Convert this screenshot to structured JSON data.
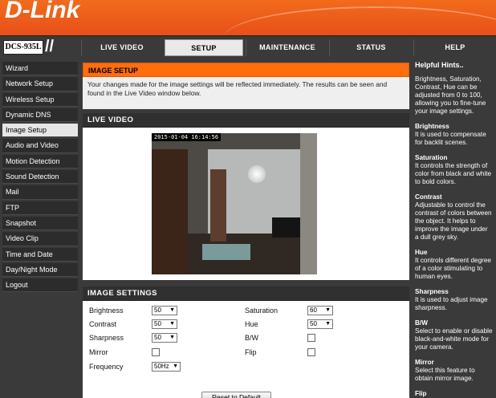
{
  "brand": {
    "logo": "D-Link",
    "model": "DCS-935L"
  },
  "nav": {
    "tabs": [
      "LIVE VIDEO",
      "SETUP",
      "MAINTENANCE",
      "STATUS",
      "HELP"
    ],
    "active": "SETUP"
  },
  "sidebar": {
    "items": [
      {
        "label": "Wizard"
      },
      {
        "label": "Network Setup"
      },
      {
        "label": "Wireless Setup"
      },
      {
        "label": "Dynamic DNS"
      },
      {
        "label": "Image Setup"
      },
      {
        "label": "Audio and Video"
      },
      {
        "label": "Motion Detection"
      },
      {
        "label": "Sound Detection"
      },
      {
        "label": "Mail"
      },
      {
        "label": "FTP"
      },
      {
        "label": "Snapshot"
      },
      {
        "label": "Video Clip"
      },
      {
        "label": "Time and Date"
      },
      {
        "label": "Day/Night Mode"
      },
      {
        "label": "Logout"
      }
    ],
    "active": "Image Setup"
  },
  "image_setup": {
    "title": "IMAGE SETUP",
    "description": "Your changes made for the image settings will be reflected immediately. The results can be seen and found in the Live Video window below."
  },
  "live_video": {
    "title": "LIVE VIDEO",
    "timestamp": "2015-01-04 16:14:56"
  },
  "image_settings": {
    "title": "IMAGE SETTINGS",
    "brightness": {
      "label": "Brightness",
      "value": "50"
    },
    "contrast": {
      "label": "Contrast",
      "value": "50"
    },
    "sharpness": {
      "label": "Sharpness",
      "value": "50"
    },
    "mirror": {
      "label": "Mirror",
      "checked": false
    },
    "frequency": {
      "label": "Frequency",
      "value": "50Hz"
    },
    "saturation": {
      "label": "Saturation",
      "value": "60"
    },
    "hue": {
      "label": "Hue",
      "value": "50"
    },
    "bw": {
      "label": "B/W",
      "checked": false
    },
    "flip": {
      "label": "Flip",
      "checked": false
    },
    "reset_label": "Reset to Default"
  },
  "hints": {
    "title": "Helpful Hints..",
    "intro": "Brightness, Saturation, Contrast, Hue can be adjusted from 0 to 100, allowing you to fine-tune your image settings.",
    "items": [
      {
        "heading": "Brightness",
        "text": "It is used to compensate for backlit scenes."
      },
      {
        "heading": "Saturation",
        "text": "It controls the strength of color from black and white to bold colors."
      },
      {
        "heading": "Contrast",
        "text": "Adjustable to control the contrast of colors between the object. It helps to improve the image under a dull grey sky."
      },
      {
        "heading": "Hue",
        "text": "It controls different degree of a color stimulating to human eyes."
      },
      {
        "heading": "Sharpness",
        "text": "It is used to adjust image sharpness."
      },
      {
        "heading": "B/W",
        "text": "Select to enable or disable black-and-white mode for your camera."
      },
      {
        "heading": "Mirror",
        "text": "Select this feature to obtain mirror image."
      },
      {
        "heading": "Flip",
        "text": ""
      }
    ]
  },
  "colors": {
    "accent": "#ff6d0d",
    "header": "#e8501a",
    "chrome": "#3a3a3a"
  }
}
